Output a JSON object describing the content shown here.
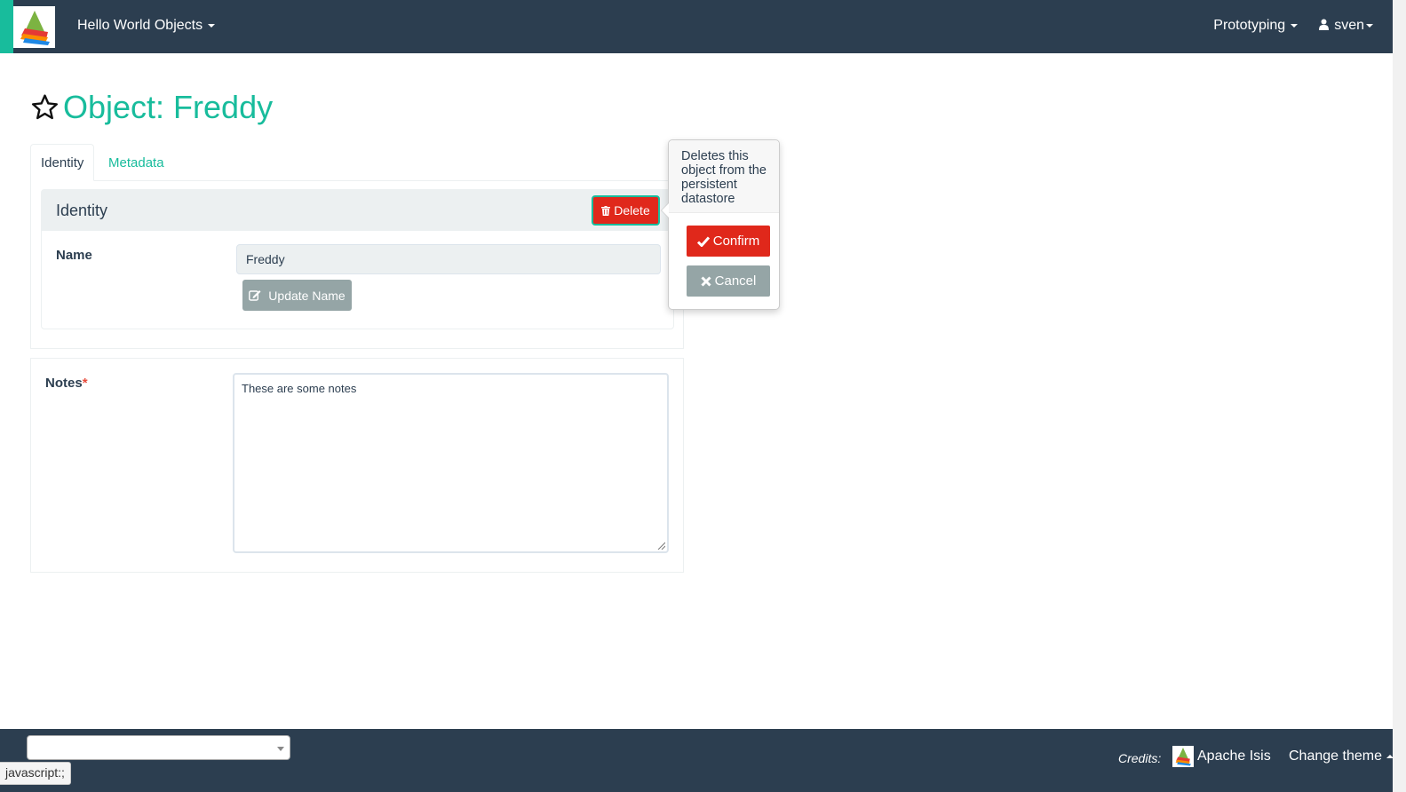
{
  "navbar": {
    "app_name": "Hello World Objects",
    "prototyping_label": "Prototyping",
    "user_label": "sven"
  },
  "page": {
    "title": "Object: Freddy"
  },
  "tabs": [
    {
      "label": "Identity",
      "active": true
    },
    {
      "label": "Metadata",
      "active": false
    }
  ],
  "identity_panel": {
    "heading": "Identity",
    "delete_label": "Delete",
    "name_label": "Name",
    "name_value": "Freddy",
    "update_name_label": "Update Name"
  },
  "notes": {
    "label": "Notes",
    "required_mark": "*",
    "value": "These are some notes"
  },
  "popover": {
    "description": "Deletes this object from the persistent datastore",
    "confirm_label": "Confirm",
    "cancel_label": "Cancel"
  },
  "footer": {
    "select_value": "",
    "credits_label": "Credits:",
    "credits_link": "Apache Isis",
    "change_theme_label": "Change theme"
  },
  "status_bar": {
    "url": "javascript:;"
  },
  "colors": {
    "navbar_bg": "#2c3e50",
    "accent": "#18bc9c",
    "danger": "#e0281b",
    "muted_button": "#95a5a6"
  },
  "icons": [
    "app-logo-icon",
    "star-outline-icon",
    "trash-icon",
    "edit-icon",
    "check-icon",
    "times-icon",
    "user-icon",
    "isis-logo-icon"
  ]
}
